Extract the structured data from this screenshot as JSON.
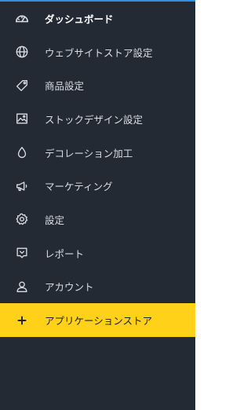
{
  "sidebar": {
    "accent_color": "#2f8fe3",
    "background_color": "#232a33",
    "highlight_color": "#ffd118",
    "items": [
      {
        "label": "ダッシュボード",
        "icon": "speedometer-icon"
      },
      {
        "label": "ウェブサイトストア設定",
        "icon": "globe-icon"
      },
      {
        "label": "商品設定",
        "icon": "tag-icon"
      },
      {
        "label": "ストックデザイン設定",
        "icon": "image-icon"
      },
      {
        "label": "デコレーション加工",
        "icon": "droplet-icon"
      },
      {
        "label": "マーケティング",
        "icon": "megaphone-icon"
      },
      {
        "label": "設定",
        "icon": "gear-icon"
      },
      {
        "label": "レポート",
        "icon": "report-icon"
      },
      {
        "label": "アカウント",
        "icon": "user-icon"
      },
      {
        "label": "アプリケーションストア",
        "icon": "plus-icon"
      }
    ]
  }
}
